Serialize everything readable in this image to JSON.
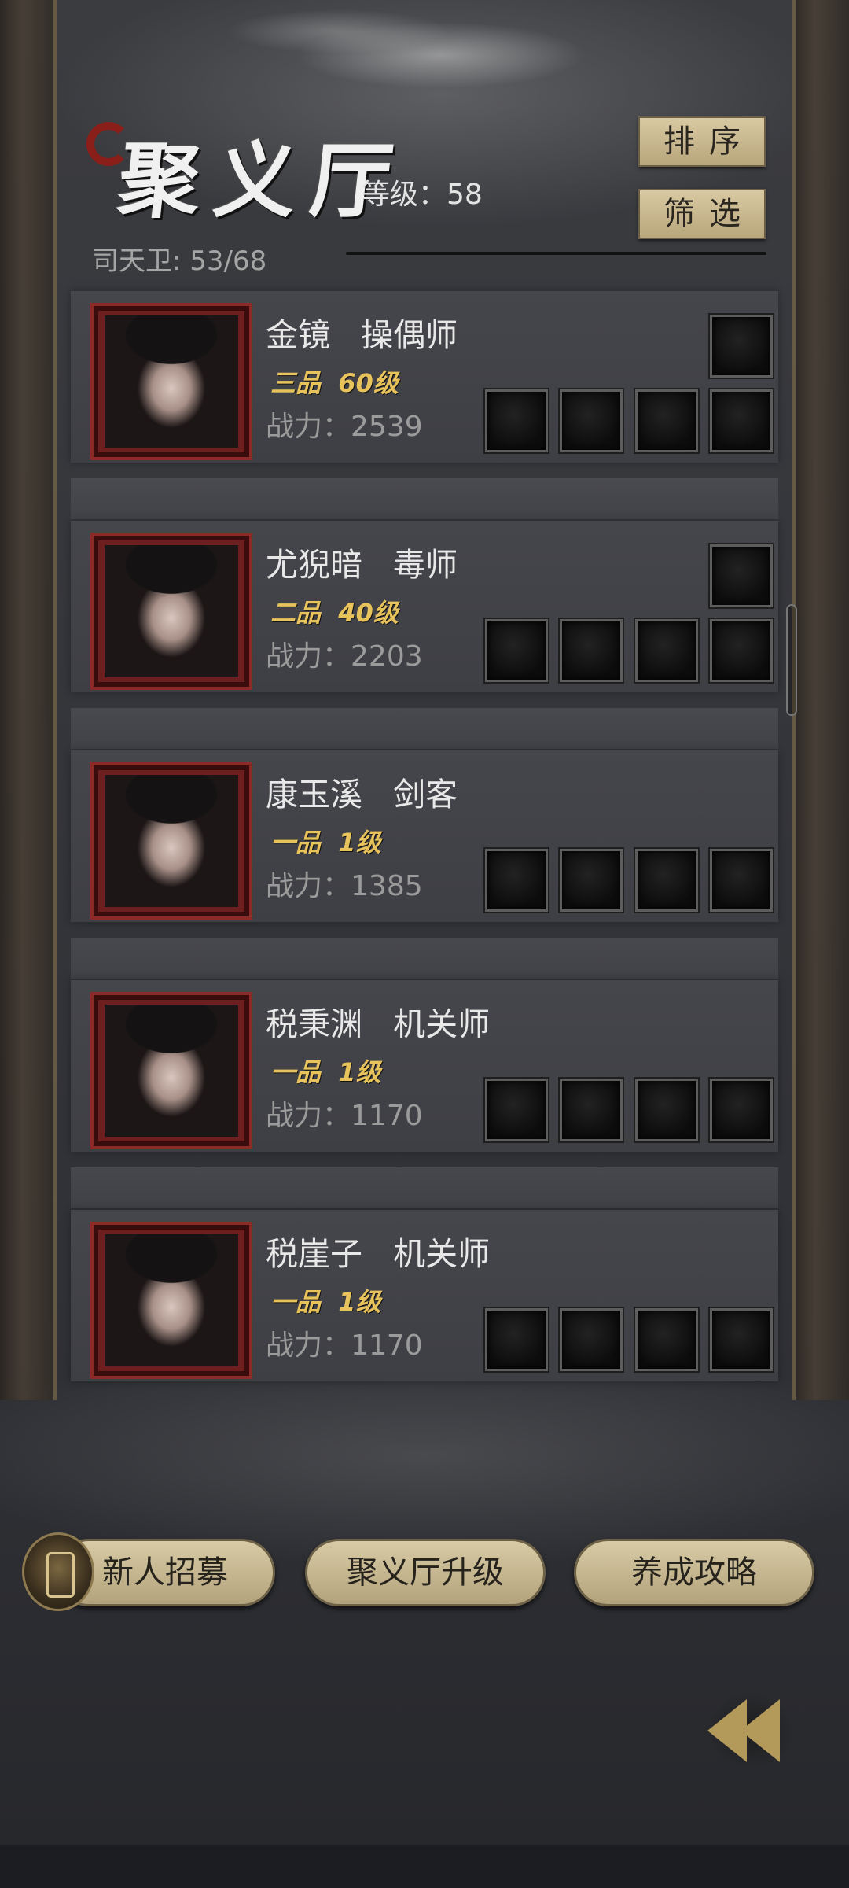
{
  "header": {
    "title": "聚义厅",
    "level_label": "等级：",
    "level_value": "58",
    "guard_label": "司天卫: ",
    "guard_value": "53/68",
    "sort_label": "排序",
    "filter_label": "筛选"
  },
  "heroes": [
    {
      "name": "金镜",
      "role": "操偶师",
      "grade": "三品",
      "level": "60级",
      "power_label": "战力：",
      "power": "2539",
      "extra_slot": true
    },
    {
      "name": "尤猊暗",
      "role": "毒师",
      "grade": "二品",
      "level": "40级",
      "power_label": "战力：",
      "power": "2203",
      "extra_slot": true
    },
    {
      "name": "康玉溪",
      "role": "剑客",
      "grade": "一品",
      "level": "1级",
      "power_label": "战力：",
      "power": "1385",
      "extra_slot": false
    },
    {
      "name": "税秉渊",
      "role": "机关师",
      "grade": "一品",
      "level": "1级",
      "power_label": "战力：",
      "power": "1170",
      "extra_slot": false
    },
    {
      "name": "税崖子",
      "role": "机关师",
      "grade": "一品",
      "level": "1级",
      "power_label": "战力：",
      "power": "1170",
      "extra_slot": false
    }
  ],
  "footer": {
    "recruit_label": "新人招募",
    "upgrade_label": "聚义厅升级",
    "guide_label": "养成攻略"
  },
  "icons": {
    "back": "double-chevron-left-icon",
    "recruit": "scroll-icon"
  },
  "colors": {
    "accent_gold": "#e8c35c",
    "button_tan": "#c9b88f",
    "portrait_red": "#8b2a27"
  }
}
